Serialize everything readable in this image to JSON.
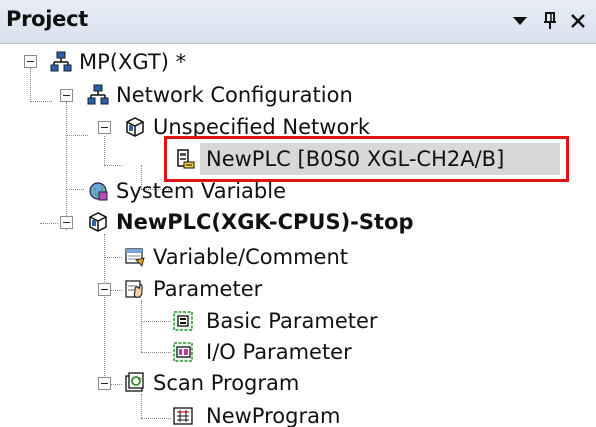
{
  "panel": {
    "title": "Project",
    "dropdown_icon": "triangle-down-icon",
    "pin_icon": "pin-icon",
    "close_icon": "close-icon"
  },
  "tree": {
    "root": {
      "label": "MP(XGT) *",
      "icon": "network-icon"
    },
    "network_config": {
      "label": "Network Configuration",
      "icon": "network-icon"
    },
    "unspecified_network": {
      "label": "Unspecified Network",
      "icon": "cube-icon"
    },
    "newplc_node": {
      "label": "NewPLC [B0S0 XGL-CH2A/B]",
      "icon": "plc-module-icon"
    },
    "system_variable": {
      "label": "System Variable",
      "icon": "globe-icon"
    },
    "plc": {
      "label": "NewPLC(XGK-CPUS)-Stop",
      "icon": "cube-icon"
    },
    "variable_comment": {
      "label": "Variable/Comment",
      "icon": "variable-icon"
    },
    "parameter": {
      "label": "Parameter",
      "icon": "parameter-icon"
    },
    "basic_parameter": {
      "label": "Basic Parameter",
      "icon": "basic-parameter-icon"
    },
    "io_parameter": {
      "label": "I/O Parameter",
      "icon": "io-parameter-icon"
    },
    "scan_program": {
      "label": "Scan Program",
      "icon": "scan-program-icon"
    },
    "new_program": {
      "label": "NewProgram",
      "icon": "program-icon"
    }
  },
  "colors": {
    "highlight_border": "#e01414",
    "selection_bg": "#d8d8d8",
    "header_bg": "#dde4ef"
  }
}
